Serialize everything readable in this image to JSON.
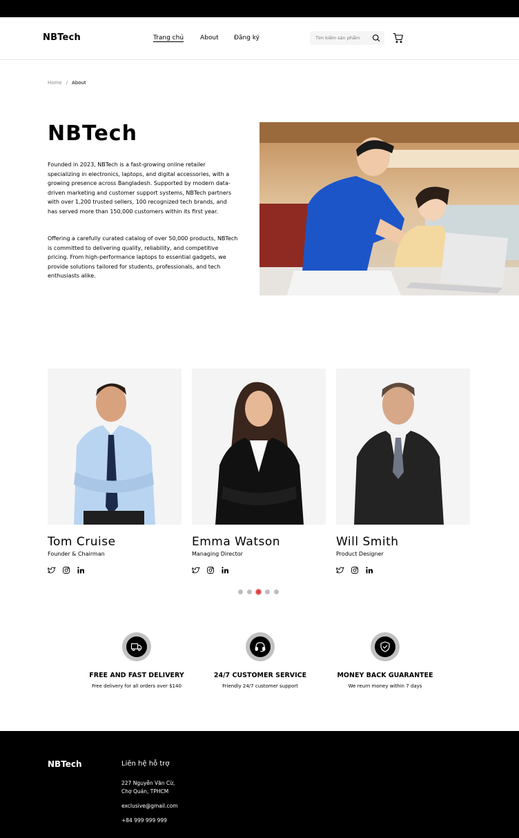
{
  "header": {
    "logo": "NBTech",
    "nav": [
      "Trang chủ",
      "About",
      "Đăng ký"
    ],
    "search_placeholder": "Tìm kiếm sản phẩm"
  },
  "breadcrumb": {
    "home": "Home",
    "separator": "/",
    "current": "About"
  },
  "hero": {
    "title": "NBTech",
    "paragraphs": [
      "Founded in 2023, NBTech is a fast-growing online retailer specializing in electronics, laptops, and digital accessories, with a growing presence across Bangladesh. Supported by modern data-driven marketing and customer support systems, NBTech partners with over 1,200 trusted sellers, 100 recognized tech brands, and has served more than 150,000 customers within its first year.",
      "Offering a carefully curated catalog of over 50,000 products, NBTech is committed to delivering quality, reliability, and competitive pricing. From high-performance laptops to essential gadgets, we provide solutions tailored for students, professionals, and tech enthusiasts alike."
    ]
  },
  "team": [
    {
      "name": "Tom Cruise",
      "role": "Founder & Chairman"
    },
    {
      "name": "Emma Watson",
      "role": "Managing Director"
    },
    {
      "name": "Will Smith",
      "role": "Product Designer"
    }
  ],
  "carousel": {
    "total": 5,
    "active": 3
  },
  "services": [
    {
      "icon": "delivery-truck-icon",
      "title": "FREE AND FAST DELIVERY",
      "subtitle": "Free delivery for all orders over $140"
    },
    {
      "icon": "headset-icon",
      "title": "24/7 CUSTOMER SERVICE",
      "subtitle": "Friendly 24/7 customer support"
    },
    {
      "icon": "shield-check-icon",
      "title": "MONEY BACK GUARANTEE",
      "subtitle": "We reurn money within 7 days"
    }
  ],
  "footer": {
    "logo": "NBTech",
    "support_heading": "Liên hệ hỗ trợ",
    "address_line1": "227 Nguyễn Văn Cừ,",
    "address_line2": "Chợ Quán, TPHCM",
    "email": "exclusive@gmail.com",
    "phone": "+84 999 999 999"
  },
  "colors": {
    "accent": "#db4444",
    "footer_bg": "#000000",
    "card_bg": "#f4f4f4"
  }
}
